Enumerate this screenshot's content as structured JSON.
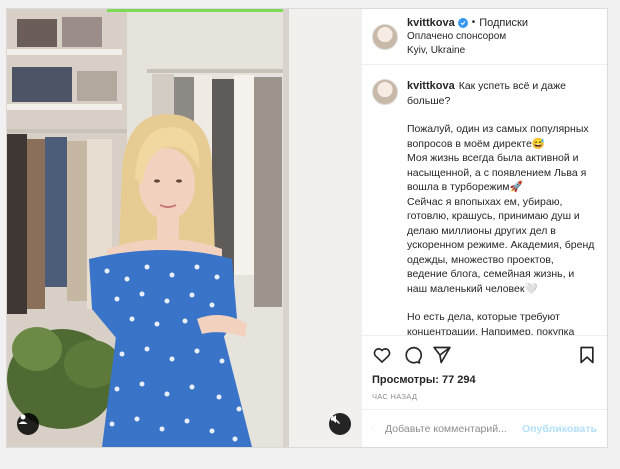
{
  "post": {
    "username": "kvittkova",
    "follow_status": "Подписки",
    "sponsored": "Оплачено спонсором",
    "location": "Kyiv, Ukraine"
  },
  "caption": {
    "username": "kvittkova",
    "first_line": "Как успеть всё и даже больше?",
    "paragraphs": [
      "Пожалуй, один из самых популярных вопросов в моём директе😅\nМоя жизнь всегда была активной и насыщенной, а с появлением Льва я вошла в турборежим🚀\nСейчас я впопыхах ем, убираю, готовлю, крашусь, принимаю душ и делаю миллионы других дел в ускоренном режиме. Академия, бренд одежды, множество проектов, ведение блога, семейная жизнь, и наш маленький человек🤍",
      "Но есть дела, которые требуют концентрации. Например, покупка"
    ]
  },
  "stats": {
    "views": "Просмотры: 77 294",
    "time_ago": "ЧАС НАЗАД"
  },
  "comment": {
    "placeholder": "Добавьте комментарий...",
    "publish_label": "Опубликовать"
  },
  "colors": {
    "verified": "#3897f0",
    "publish_disabled": "#b2dffc",
    "dress": "#3a74c9"
  },
  "icons": [
    "heart-icon",
    "comment-icon",
    "share-icon",
    "save-icon",
    "emoji-icon",
    "user-tag-icon",
    "mute-icon",
    "verified-icon"
  ]
}
